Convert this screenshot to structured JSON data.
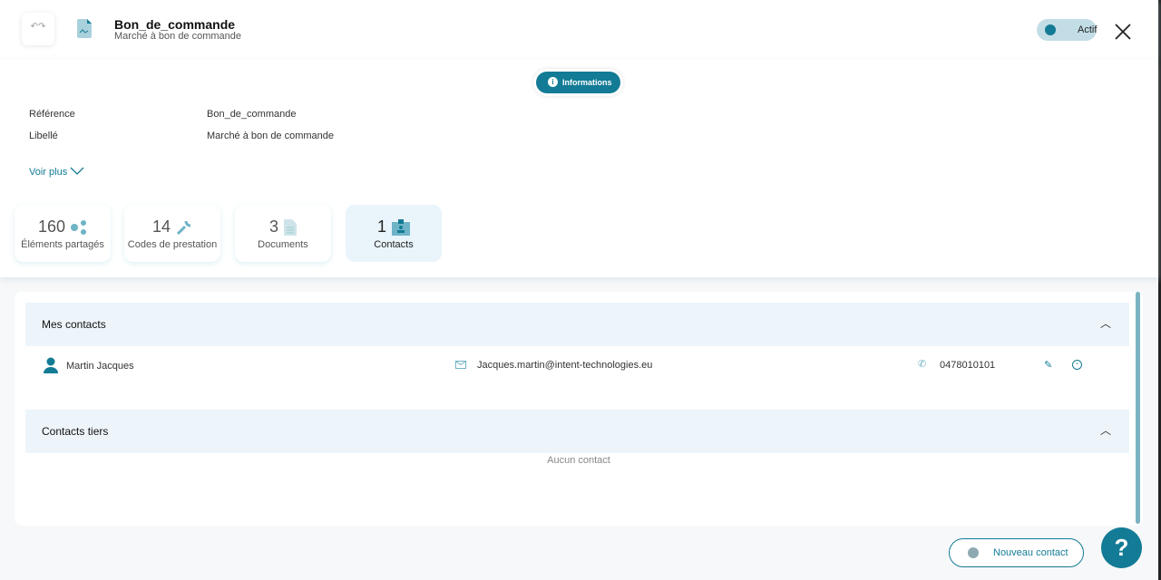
{
  "header": {
    "title": "Bon_de_commande",
    "subtitle": "Marché à bon de commande",
    "status": "Actif"
  },
  "tabs": {
    "info": "Informations"
  },
  "fields": [
    {
      "label": "Référence",
      "value": "Bon_de_commande"
    },
    {
      "label": "Libellé",
      "value": "Marché à bon de commande"
    }
  ],
  "voir_plus": "Voir plus",
  "stats": [
    {
      "count": "160",
      "label": "Éléments partagés"
    },
    {
      "count": "14",
      "label": "Codes de prestation"
    },
    {
      "count": "3",
      "label": "Documents"
    },
    {
      "count": "1",
      "label": "Contacts"
    }
  ],
  "sections": {
    "mes_contacts": "Mes contacts",
    "contacts_tiers": "Contacts tiers",
    "empty": "Aucun contact"
  },
  "contact": {
    "name": "Martin Jacques",
    "email": "Jacques.martin@intent-technologies.eu",
    "phone": "0478010101"
  },
  "buttons": {
    "new_contact": "Nouveau contact",
    "help": "?"
  },
  "colors": {
    "accent": "#137b95"
  }
}
